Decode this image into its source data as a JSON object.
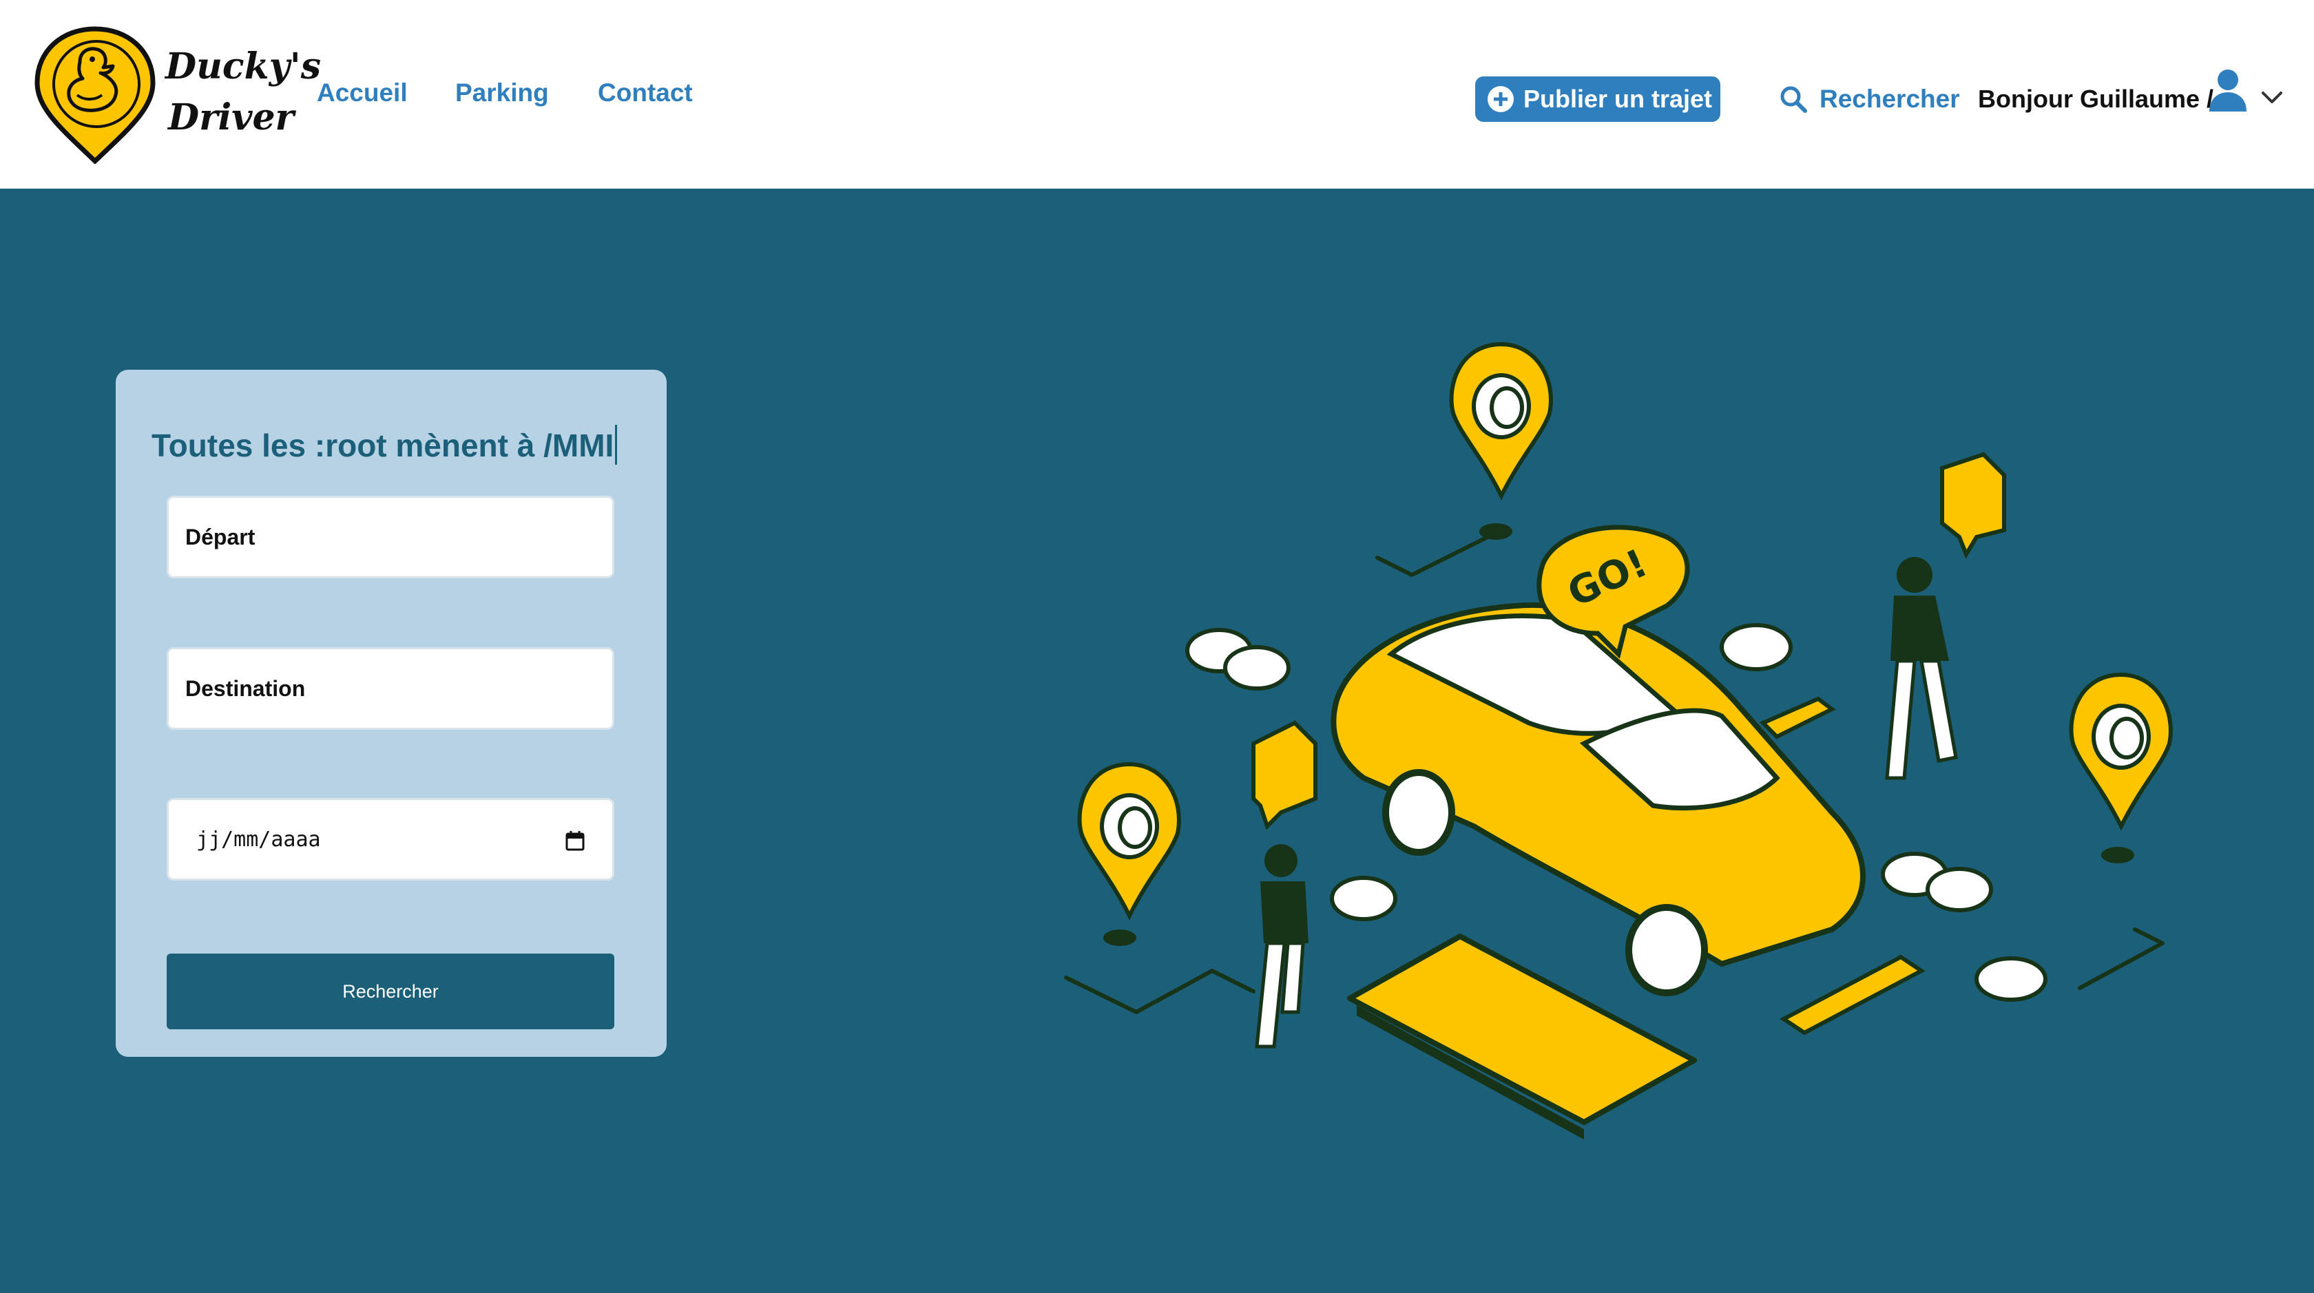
{
  "header": {
    "logo_text_line1": "Ducky's",
    "logo_text_line2": "Driver",
    "nav": [
      {
        "label": "Accueil"
      },
      {
        "label": "Parking"
      },
      {
        "label": "Contact"
      }
    ],
    "publish_label": "Publier un trajet",
    "search_label": "Rechercher",
    "greeting": "Bonjour Guillaume /"
  },
  "search": {
    "title": "Toutes les :root mènent à /MMI",
    "departure_label": "Départ",
    "destination_label": "Destination",
    "date_placeholder": "jj/mm/aaaa",
    "submit_label": "Rechercher"
  },
  "icons": {
    "logo": "duck-pin-logo",
    "publish": "plus-circle-icon",
    "search": "search-icon",
    "user": "user-icon",
    "chevron": "chevron-down-icon",
    "calendar": "calendar-icon"
  },
  "colors": {
    "primary_dark": "#1c5f79",
    "primary_blue": "#2f7fbf",
    "card_bg": "#b7d2e5",
    "accent_yellow": "#fdc500"
  }
}
